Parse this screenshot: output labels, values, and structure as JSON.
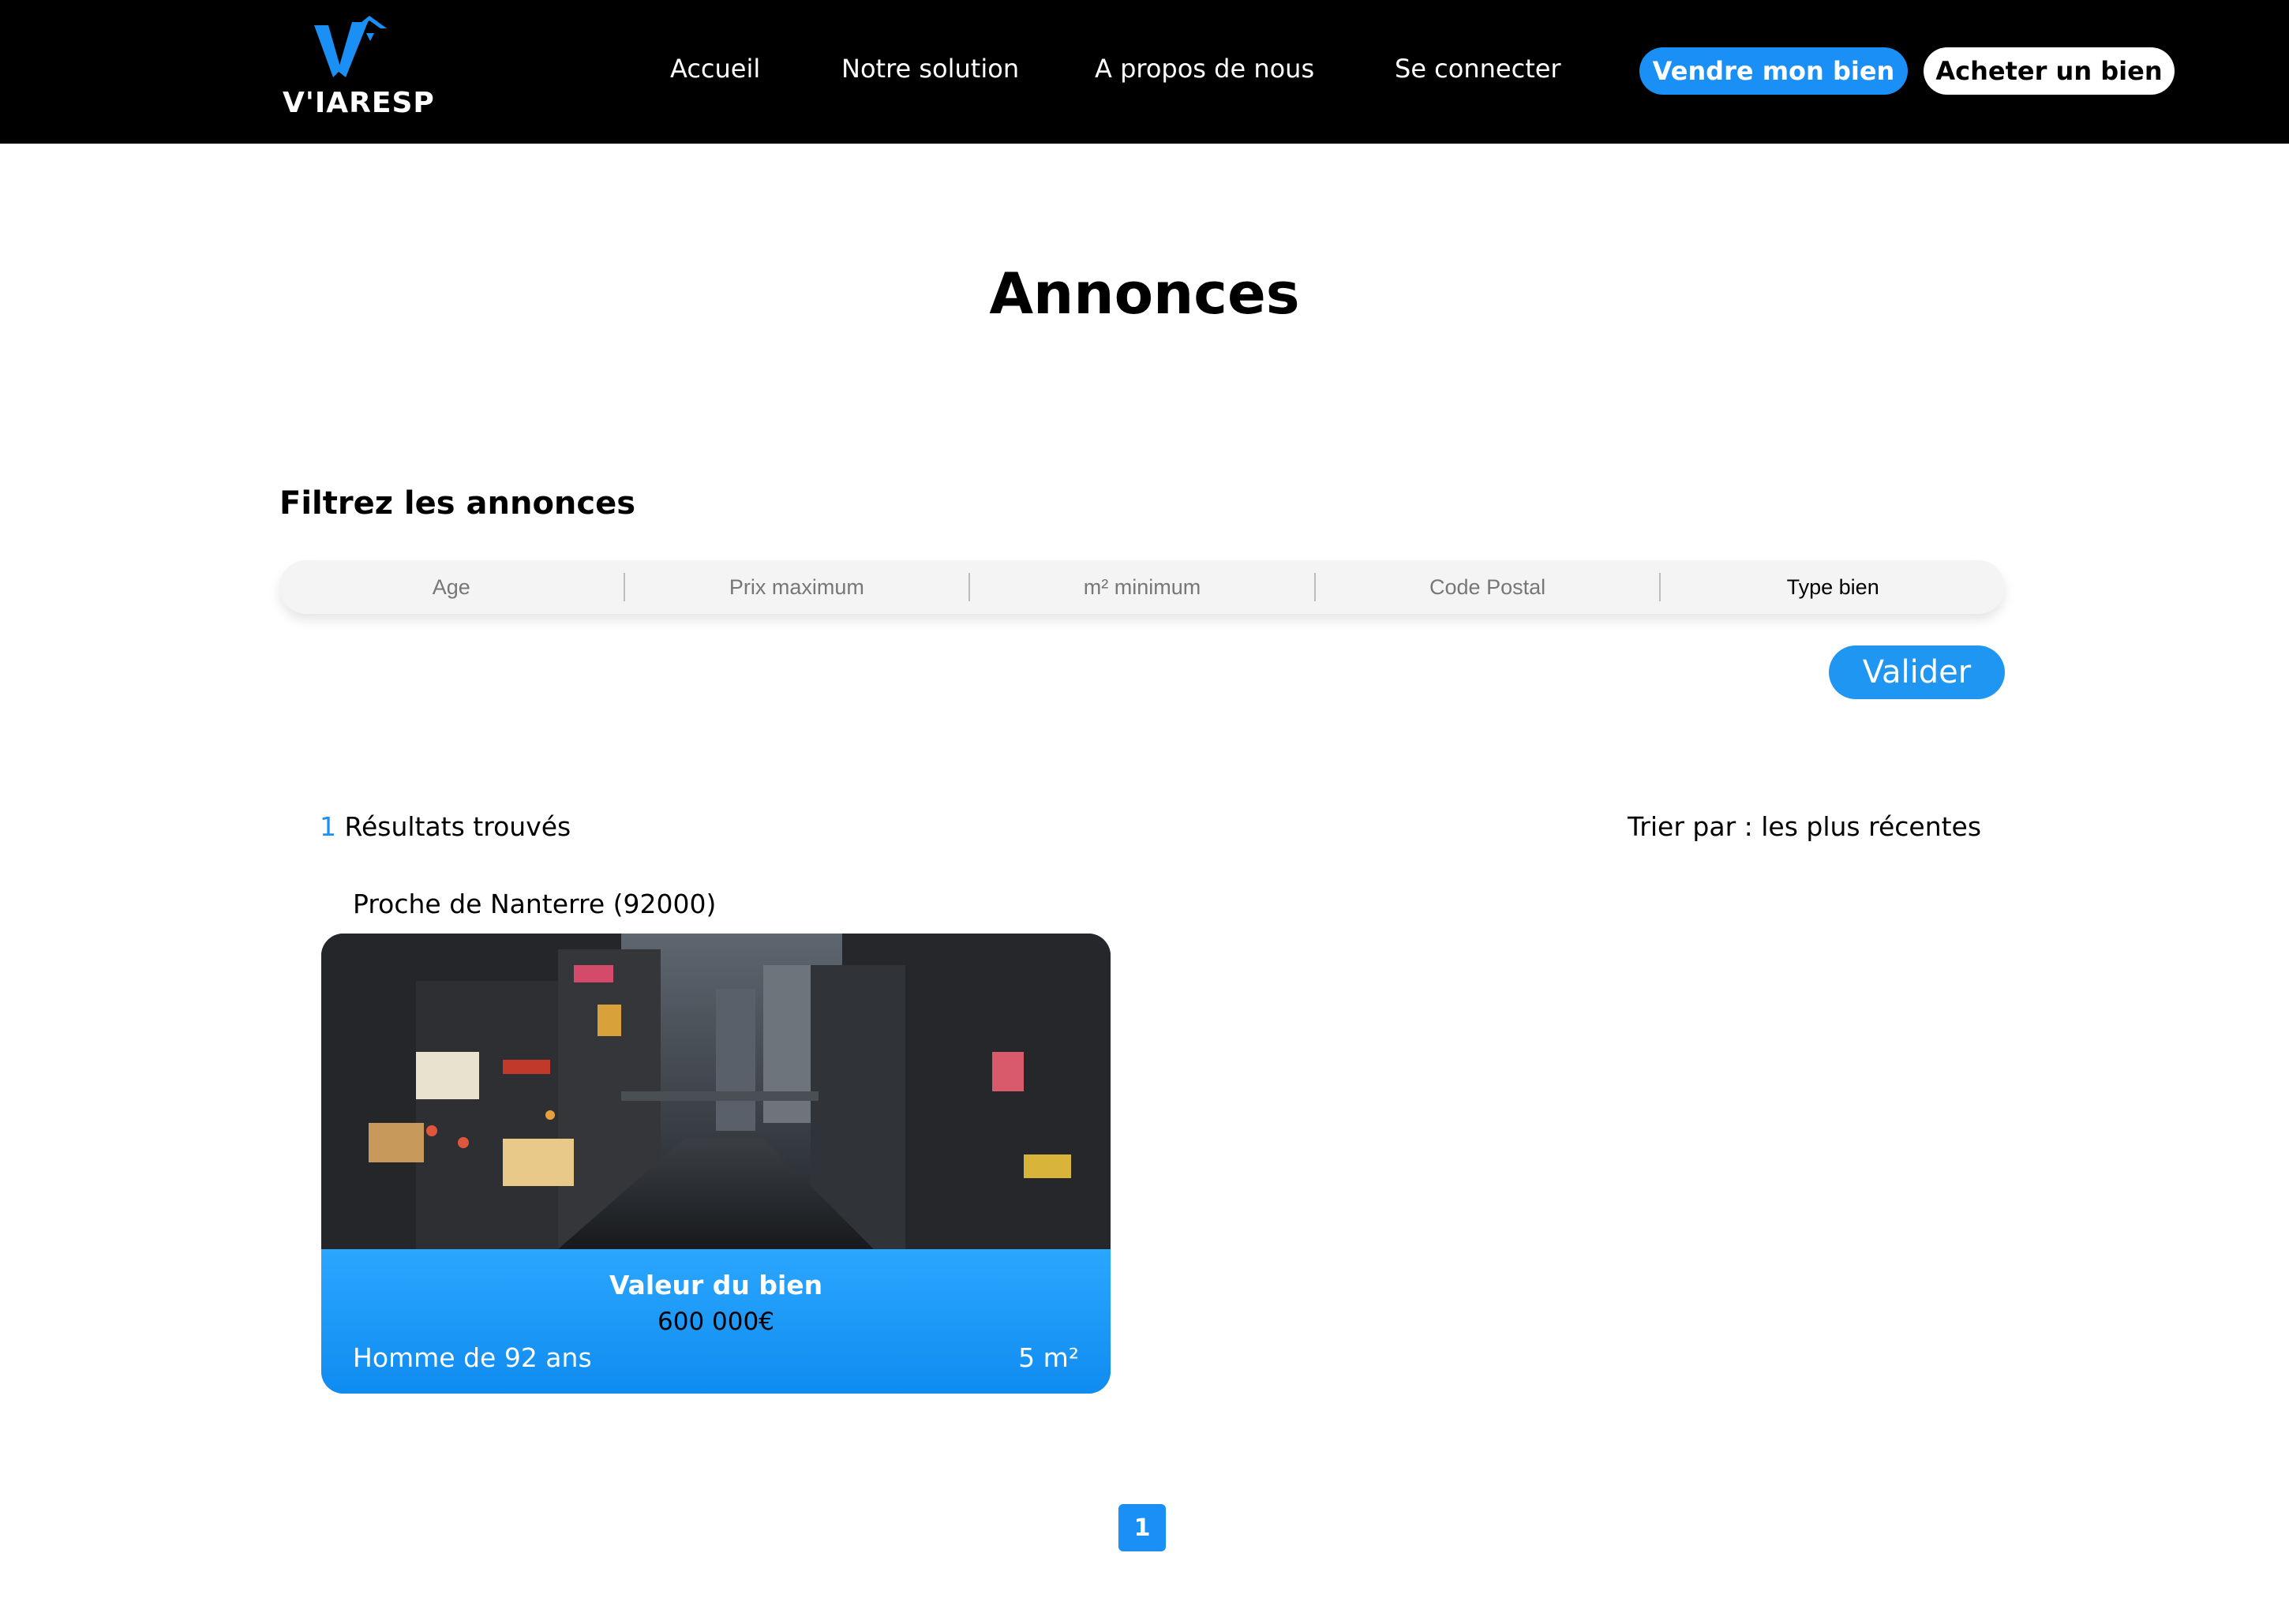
{
  "header": {
    "logo_text": "V'IARESP",
    "nav": [
      "Accueil",
      "Notre solution",
      "A propos de nous",
      "Se connecter"
    ],
    "sell_button": "Vendre mon bien",
    "buy_button": "Acheter un bien"
  },
  "page": {
    "title": "Annonces"
  },
  "filters": {
    "heading": "Filtrez les annonces",
    "fields": [
      "Age",
      "Prix maximum",
      "m² minimum",
      "Code Postal",
      "Type bien"
    ],
    "submit": "Valider"
  },
  "results": {
    "count": "1",
    "label": "Résultats trouvés",
    "sort": "Trier par : les plus récentes"
  },
  "listing": {
    "location": "Proche de Nanterre (92000)",
    "image": "city-street-night-photo",
    "value_label": "Valeur du bien",
    "price": "600 000€",
    "owner": "Homme de 92 ans",
    "area": "5 m²"
  },
  "pagination": {
    "current": "1"
  },
  "colors": {
    "accent": "#1a8ff5",
    "header_bg": "#000000"
  }
}
